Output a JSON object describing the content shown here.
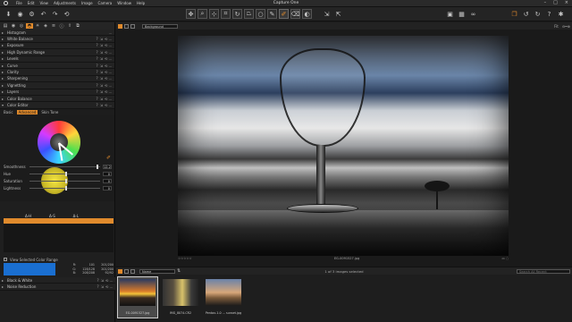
{
  "app": {
    "title": "Capture One",
    "menu": [
      "File",
      "Edit",
      "View",
      "Adjustments",
      "Image",
      "Camera",
      "Window",
      "Help"
    ]
  },
  "left_panel": {
    "tools": [
      {
        "label": "Histogram"
      },
      {
        "label": "White Balance"
      },
      {
        "label": "Exposure"
      },
      {
        "label": "High Dynamic Range"
      },
      {
        "label": "Levels"
      },
      {
        "label": "Curve"
      },
      {
        "label": "Clarity"
      },
      {
        "label": "Sharpening"
      },
      {
        "label": "Vignetting"
      },
      {
        "label": "Layers"
      },
      {
        "label": "Color Balance"
      },
      {
        "label": "Color Editor"
      }
    ],
    "color_editor": {
      "tabs": [
        "Basic",
        "Advanced",
        "Skin Tone"
      ],
      "active_tab": "Advanced",
      "sliders": [
        {
          "label": "Smoothness",
          "value": "12.2",
          "fraction": 0.95
        },
        {
          "label": "Hue",
          "value": "0",
          "fraction": 0.5
        },
        {
          "label": "Saturation",
          "value": "0",
          "fraction": 0.5
        },
        {
          "label": "Lightness",
          "value": "0",
          "fraction": 0.5
        }
      ],
      "range_header": [
        "Δ-H",
        "Δ-S",
        "Δ-L"
      ],
      "view_selected_label": "View Selected Color Range",
      "info_rows": [
        [
          "R:",
          "101",
          "201/200"
        ],
        [
          "G:",
          "128/128",
          "201/200"
        ],
        [
          "B:",
          "208/208",
          "92/92"
        ]
      ],
      "swatch_color": "#1a6fd1"
    },
    "bottom_tools": [
      {
        "label": "Black & White"
      },
      {
        "label": "Noise Reduction"
      }
    ]
  },
  "viewer": {
    "background_dropdown": "Background",
    "caption": "EG-0091527.jpg",
    "zoom": "Fit"
  },
  "browser": {
    "sort_label": "Name",
    "count_text": "1 of 3 images selected",
    "search_placeholder": "Search All Recent",
    "thumbnails": [
      {
        "filename": "EG-0091527.jpg",
        "selected": true
      },
      {
        "filename": "IMG_8074.CR2",
        "selected": false
      },
      {
        "filename": "Pentax-1.0 … sunset.jpg",
        "selected": false
      }
    ]
  },
  "colors": {
    "accent": "#e08a2c",
    "panel_bg": "#1f1f1f",
    "swatch_blue": "#1a6fd1"
  }
}
